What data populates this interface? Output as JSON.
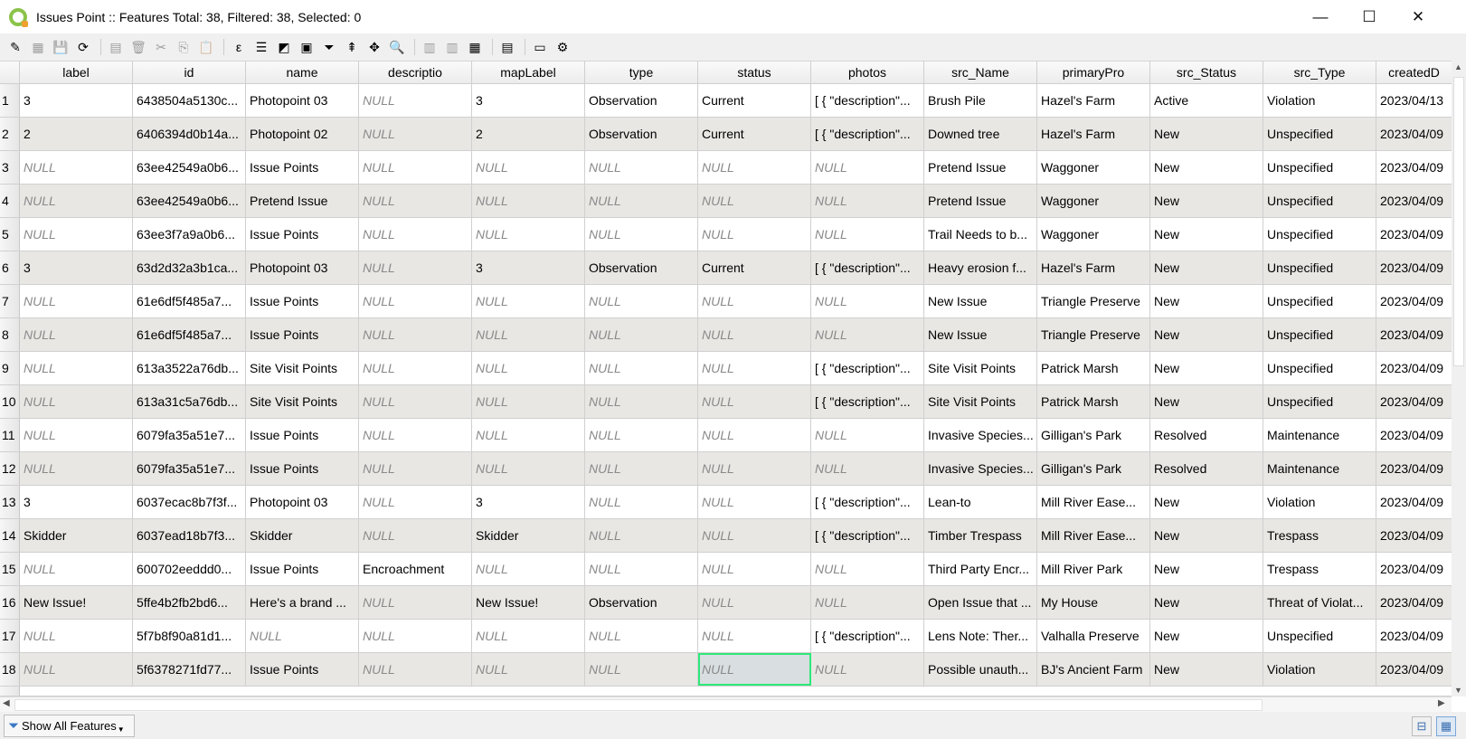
{
  "window": {
    "title": "Issues Point :: Features Total: 38, Filtered: 38, Selected: 0",
    "minimize": "—",
    "maximize": "☐",
    "close": "✕"
  },
  "toolbar": [
    {
      "icon": "pencil-icon",
      "glyph": "✎",
      "enabled": true
    },
    {
      "icon": "multi-edit-icon",
      "glyph": "▦",
      "enabled": false
    },
    {
      "icon": "save-icon",
      "glyph": "💾",
      "enabled": false
    },
    {
      "icon": "reload-icon",
      "glyph": "⟳",
      "enabled": true
    },
    {
      "sep": true
    },
    {
      "icon": "add-feature-icon",
      "glyph": "▤",
      "enabled": false
    },
    {
      "icon": "delete-icon",
      "glyph": "🗑",
      "enabled": false
    },
    {
      "icon": "cut-icon",
      "glyph": "✂",
      "enabled": false
    },
    {
      "icon": "copy-icon",
      "glyph": "⎘",
      "enabled": false
    },
    {
      "icon": "paste-icon",
      "glyph": "📋",
      "enabled": false
    },
    {
      "sep": true
    },
    {
      "icon": "select-by-expression-icon",
      "glyph": "ε",
      "enabled": true
    },
    {
      "icon": "select-all-icon",
      "glyph": "☰",
      "enabled": true
    },
    {
      "icon": "invert-selection-icon",
      "glyph": "◩",
      "enabled": true
    },
    {
      "icon": "deselect-icon",
      "glyph": "▣",
      "enabled": true
    },
    {
      "icon": "filter-icon",
      "glyph": "⏷",
      "enabled": true
    },
    {
      "icon": "move-selection-top-icon",
      "glyph": "⇞",
      "enabled": true
    },
    {
      "icon": "pan-to-selection-icon",
      "glyph": "✥",
      "enabled": true
    },
    {
      "icon": "zoom-to-selection-icon",
      "glyph": "🔍",
      "enabled": true
    },
    {
      "sep": true
    },
    {
      "icon": "new-field-icon",
      "glyph": "▥",
      "enabled": false
    },
    {
      "icon": "delete-field-icon",
      "glyph": "▥",
      "enabled": false
    },
    {
      "icon": "field-calculator-icon",
      "glyph": "▦",
      "enabled": true
    },
    {
      "sep": true
    },
    {
      "icon": "conditional-formatting-icon",
      "glyph": "▤",
      "enabled": true
    },
    {
      "sep": true
    },
    {
      "icon": "dock-icon",
      "glyph": "▭",
      "enabled": true
    },
    {
      "icon": "actions-icon",
      "glyph": "⚙",
      "enabled": true
    }
  ],
  "columns": [
    "label",
    "id",
    "name",
    "descriptio",
    "mapLabel",
    "type",
    "status",
    "photos",
    "src_Name",
    "primaryPro",
    "src_Status",
    "src_Type",
    "createdD"
  ],
  "rows": [
    [
      "1",
      "3",
      "6438504a5130c...",
      "Photopoint 03",
      "NULL",
      "3",
      "Observation",
      "Current",
      "[ { \"description\"...",
      "Brush Pile",
      "Hazel's Farm",
      "Active",
      "Violation",
      "2023/04/13"
    ],
    [
      "2",
      "2",
      "6406394d0b14a...",
      "Photopoint 02",
      "NULL",
      "2",
      "Observation",
      "Current",
      "[ { \"description\"...",
      "Downed tree",
      "Hazel's Farm",
      "New",
      "Unspecified",
      "2023/04/09"
    ],
    [
      "3",
      "NULL",
      "63ee42549a0b6...",
      "Issue Points",
      "NULL",
      "NULL",
      "NULL",
      "NULL",
      "NULL",
      "Pretend Issue",
      "Waggoner",
      "New",
      "Unspecified",
      "2023/04/09"
    ],
    [
      "4",
      "NULL",
      "63ee42549a0b6...",
      "Pretend Issue",
      "NULL",
      "NULL",
      "NULL",
      "NULL",
      "NULL",
      "Pretend Issue",
      "Waggoner",
      "New",
      "Unspecified",
      "2023/04/09"
    ],
    [
      "5",
      "NULL",
      "63ee3f7a9a0b6...",
      "Issue Points",
      "NULL",
      "NULL",
      "NULL",
      "NULL",
      "NULL",
      "Trail Needs to b...",
      "Waggoner",
      "New",
      "Unspecified",
      "2023/04/09"
    ],
    [
      "6",
      "3",
      "63d2d32a3b1ca...",
      "Photopoint 03",
      "NULL",
      "3",
      "Observation",
      "Current",
      "[ { \"description\"...",
      "Heavy erosion f...",
      "Hazel's Farm",
      "New",
      "Unspecified",
      "2023/04/09"
    ],
    [
      "7",
      "NULL",
      "61e6df5f485a7...",
      "Issue Points",
      "NULL",
      "NULL",
      "NULL",
      "NULL",
      "NULL",
      "New Issue",
      "Triangle Preserve",
      "New",
      "Unspecified",
      "2023/04/09"
    ],
    [
      "8",
      "NULL",
      "61e6df5f485a7...",
      "Issue Points",
      "NULL",
      "NULL",
      "NULL",
      "NULL",
      "NULL",
      "New Issue",
      "Triangle Preserve",
      "New",
      "Unspecified",
      "2023/04/09"
    ],
    [
      "9",
      "NULL",
      "613a3522a76db...",
      "Site Visit Points",
      "NULL",
      "NULL",
      "NULL",
      "NULL",
      "[ { \"description\"...",
      "Site Visit Points",
      "Patrick Marsh",
      "New",
      "Unspecified",
      "2023/04/09"
    ],
    [
      "10",
      "NULL",
      "613a31c5a76db...",
      "Site Visit Points",
      "NULL",
      "NULL",
      "NULL",
      "NULL",
      "[ { \"description\"...",
      "Site Visit Points",
      "Patrick Marsh",
      "New",
      "Unspecified",
      "2023/04/09"
    ],
    [
      "11",
      "NULL",
      "6079fa35a51e7...",
      "Issue Points",
      "NULL",
      "NULL",
      "NULL",
      "NULL",
      "NULL",
      "Invasive Species...",
      "Gilligan's Park",
      "Resolved",
      "Maintenance",
      "2023/04/09"
    ],
    [
      "12",
      "NULL",
      "6079fa35a51e7...",
      "Issue Points",
      "NULL",
      "NULL",
      "NULL",
      "NULL",
      "NULL",
      "Invasive Species...",
      "Gilligan's Park",
      "Resolved",
      "Maintenance",
      "2023/04/09"
    ],
    [
      "13",
      "3",
      "6037ecac8b7f3f...",
      "Photopoint 03",
      "NULL",
      "3",
      "NULL",
      "NULL",
      "[ { \"description\"...",
      "Lean-to",
      "Mill River Ease...",
      "New",
      "Violation",
      "2023/04/09"
    ],
    [
      "14",
      "Skidder",
      "6037ead18b7f3...",
      "Skidder",
      "NULL",
      "Skidder",
      "NULL",
      "NULL",
      "[ { \"description\"...",
      "Timber Trespass",
      "Mill River Ease...",
      "New",
      "Trespass",
      "2023/04/09"
    ],
    [
      "15",
      "NULL",
      "600702eeddd0...",
      "Issue Points",
      "Encroachment",
      "NULL",
      "NULL",
      "NULL",
      "NULL",
      "Third Party Encr...",
      "Mill River Park",
      "New",
      "Trespass",
      "2023/04/09"
    ],
    [
      "16",
      "New Issue!",
      "5ffe4b2fb2bd6...",
      "Here's a brand ...",
      "NULL",
      "New Issue!",
      "Observation",
      "NULL",
      "NULL",
      "Open Issue that ...",
      "My House",
      "New",
      "Threat of Violat...",
      "2023/04/09"
    ],
    [
      "17",
      "NULL",
      "5f7b8f90a81d1...",
      "NULL",
      "NULL",
      "NULL",
      "NULL",
      "NULL",
      "[ { \"description\"...",
      "Lens Note: Ther...",
      "Valhalla Preserve",
      "New",
      "Unspecified",
      "2023/04/09"
    ],
    [
      "18",
      "NULL",
      "5f6378271fd77...",
      "Issue Points",
      "NULL",
      "NULL",
      "NULL",
      "NULL",
      "NULL",
      "Possible unauth...",
      "BJ's Ancient Farm",
      "New",
      "Violation",
      "2023/04/09"
    ]
  ],
  "selected_cell": {
    "row": 18,
    "column": "status"
  },
  "footer": {
    "filter_button": "Show All Features"
  },
  "colors": {
    "selection_border": "#2ee87a",
    "alt_row": "#e8e7e4",
    "null_text": "#8a8a8a"
  }
}
